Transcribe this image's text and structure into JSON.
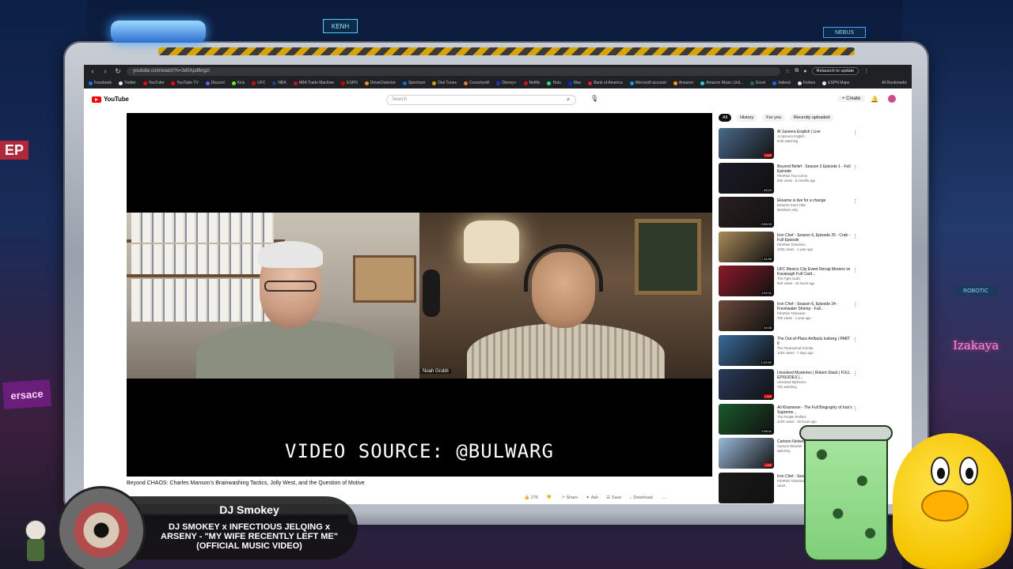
{
  "background": {
    "signs": {
      "ep": "EP",
      "izakaya": "Izakaya",
      "versace": "ersace",
      "robotic": "ROBOTIC",
      "top_sign": "KENH",
      "top_right_sign": "NEBUS"
    }
  },
  "browser": {
    "url": "youtube.com/watch?v=3d0ApdfkrgzI",
    "relaunch_label": "Relaunch to update",
    "bookmarks": [
      {
        "label": "Facebook",
        "color": "#1877f2"
      },
      {
        "label": "Twitter",
        "color": "#e8eaed"
      },
      {
        "label": "YouTube",
        "color": "#ff0000"
      },
      {
        "label": "YouTube TV",
        "color": "#ff0000"
      },
      {
        "label": "Discord",
        "color": "#5865f2"
      },
      {
        "label": "Kick",
        "color": "#53fc18"
      },
      {
        "label": "UFC",
        "color": "#d20a0a"
      },
      {
        "label": "NBA",
        "color": "#1d428a"
      },
      {
        "label": "NBA Trade Machine",
        "color": "#c8102e"
      },
      {
        "label": "ESPN",
        "color": "#d00"
      },
      {
        "label": "DriverDetector",
        "color": "#f28c28"
      },
      {
        "label": "Spectrum",
        "color": "#0073d1"
      },
      {
        "label": "Dial Tunes",
        "color": "#d4a100"
      },
      {
        "label": "Crunchyroll",
        "color": "#f47521"
      },
      {
        "label": "Disney+",
        "color": "#113ccf"
      },
      {
        "label": "Netflix",
        "color": "#e50914"
      },
      {
        "label": "Hulu",
        "color": "#1ce783"
      },
      {
        "label": "Max",
        "color": "#002be7"
      },
      {
        "label": "Bank of America",
        "color": "#e31837"
      },
      {
        "label": "Microsoft account",
        "color": "#00a4ef"
      },
      {
        "label": "Amazon",
        "color": "#ff9900"
      },
      {
        "label": "Amazon Music Unli...",
        "color": "#25d1da"
      },
      {
        "label": "Excel",
        "color": "#217346"
      },
      {
        "label": "Indeed",
        "color": "#2164f3"
      },
      {
        "label": "Forbes",
        "color": "#e8eaed"
      },
      {
        "label": "ESPN Maps",
        "color": "#e8eaed"
      }
    ],
    "all_bookmarks_label": "All Bookmarks"
  },
  "youtube": {
    "logo_text": "YouTube",
    "search_placeholder": "Search",
    "create_label": "Create",
    "player": {
      "video_source_text": "VIDEO SOURCE: @BULWARG",
      "name_tag": "Noah Grubb"
    },
    "video_title": "Beyond CHAOS: Charles Manson's Brainwashing Tactics, Jolly West, and the Question of Motive",
    "actions": [
      {
        "label": "276",
        "icon": "thumbs-up-icon"
      },
      {
        "label": "",
        "icon": "thumbs-down-icon"
      },
      {
        "label": "Share",
        "icon": "share-icon"
      },
      {
        "label": "Ask",
        "icon": "sparkle-icon"
      },
      {
        "label": "Save",
        "icon": "save-icon"
      },
      {
        "label": "Download",
        "icon": "download-icon"
      },
      {
        "label": "...",
        "icon": "more-icon"
      }
    ],
    "chips": [
      {
        "label": "All",
        "active": true
      },
      {
        "label": "History",
        "active": false
      },
      {
        "label": "For you",
        "active": false
      },
      {
        "label": "Recently uploaded",
        "active": false
      }
    ],
    "recommendations": [
      {
        "title": "Al Jazeera English | Live",
        "channel": "Al Jazeera English",
        "stats": "9.6K watching",
        "badge": "LIVE",
        "badge_type": "live",
        "thumb_color": "#4a6a8a"
      },
      {
        "title": "Beyond Belief - Season 3 Episode 1 - Full Episode",
        "channel": "FilmRise True Crime",
        "stats": "89K views · 5 months ago",
        "badge": "43:24",
        "badge_type": "time",
        "thumb_color": "#1a1a2a"
      },
      {
        "title": "Ekvarne is live for a change",
        "channel": "Ekvarne Goes Hike",
        "stats": "Members only",
        "badge": "2:53:03",
        "badge_type": "time",
        "thumb_color": "#2a2020"
      },
      {
        "title": "Iron Chef - Season 6, Episode 25 - Crab - Full Episode",
        "channel": "FilmRise Television",
        "stats": "103K views · 1 year ago",
        "badge": "41:56",
        "badge_type": "time",
        "thumb_color": "#a88a5a"
      },
      {
        "title": "UFC Mexico City Event Recap Moreno vs Kavanagh Full Card...",
        "channel": "The Fight Guild",
        "stats": "50K views · 16 hours ago",
        "badge": "1:02:11",
        "badge_type": "time",
        "thumb_color": "#8a1a2a"
      },
      {
        "title": "Iron Chef - Season 6, Episode 24 - Freshwater Shrimp - Full...",
        "channel": "FilmRise Television",
        "stats": "76K views · 1 year ago",
        "badge": "41:08",
        "badge_type": "time",
        "thumb_color": "#6a4a3a"
      },
      {
        "title": "The Out-of-Place Artifacts Iceberg | PART 6",
        "channel": "The Paranormal Scholar",
        "stats": "101K views · 7 days ago",
        "badge": "1:22:52",
        "badge_type": "time",
        "thumb_color": "#3a6a9a"
      },
      {
        "title": "Unsolved Mysteries | Robert Stack | FULL EPISODES |...",
        "channel": "Unsolved Mysteries",
        "stats": "781 watching",
        "badge": "LIVE",
        "badge_type": "live",
        "thumb_color": "#2a3a5a"
      },
      {
        "title": "Ali Khamenei - The Full Biography of Iran's Supreme...",
        "channel": "The People Profiles",
        "stats": "122K views · 16 hours ago",
        "badge": "1:08:11",
        "badge_type": "time",
        "thumb_color": "#1a5a2a"
      },
      {
        "title": "Cartoon Network...",
        "channel": "Cartoon Network",
        "stats": "watching",
        "badge": "LIVE",
        "badge_type": "live",
        "thumb_color": "#9abada"
      },
      {
        "title": "Iron Chef - Season 4 - Blood Feud",
        "channel": "FilmRise Television",
        "stats": "views",
        "badge": "",
        "badge_type": "time",
        "thumb_color": "#1a1a1a"
      }
    ]
  },
  "now_playing": {
    "artist": "DJ Smokey",
    "song": "DJ SMOKEY x INFECTIOUS JELQING x ARSENY - \"MY WIFE RECENTLY LEFT ME\" (OFFICIAL MUSIC VIDEO)"
  }
}
